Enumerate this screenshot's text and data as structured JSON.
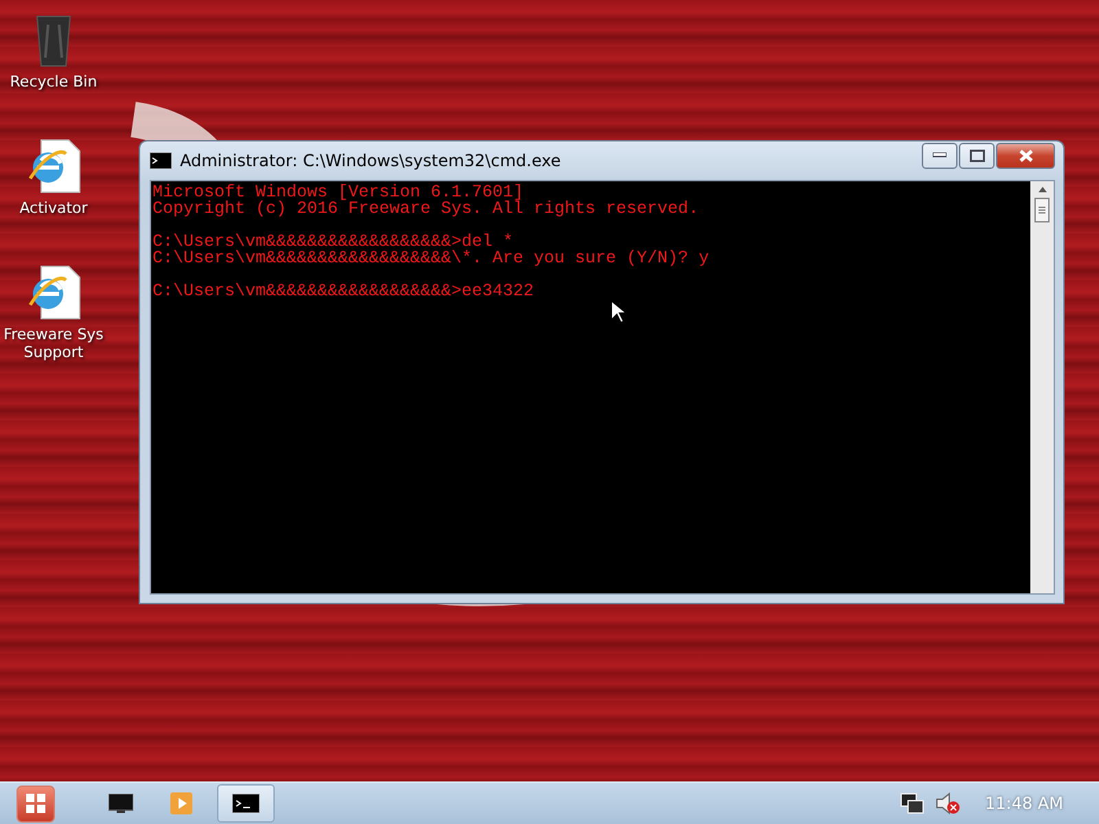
{
  "desktop_icons": [
    {
      "kind": "recycle-bin",
      "label": "Recycle Bin"
    },
    {
      "kind": "browser",
      "label": "Activator"
    },
    {
      "kind": "browser",
      "label": "Freeware Sys Support"
    }
  ],
  "window": {
    "title": "Administrator: C:\\Windows\\system32\\cmd.exe",
    "console_blocks": [
      [
        "Microsoft Windows [Version 6.1.7601]",
        "Copyright (c) 2016 Freeware Sys. All rights reserved."
      ],
      [
        "C:\\Users\\vm&&&&&&&&&&&&&&&&&&>del *",
        "C:\\Users\\vm&&&&&&&&&&&&&&&&&&\\*. Are you sure (Y/N)? y"
      ],
      [
        "C:\\Users\\vm&&&&&&&&&&&&&&&&&&>ee34322"
      ]
    ]
  },
  "taskbar": {
    "items": [
      {
        "kind": "terminal",
        "selected": false
      },
      {
        "kind": "media",
        "selected": false
      },
      {
        "kind": "console",
        "selected": true
      }
    ],
    "tray": [
      {
        "kind": "network"
      },
      {
        "kind": "volume-muted"
      }
    ],
    "clock": "11:48 AM"
  }
}
